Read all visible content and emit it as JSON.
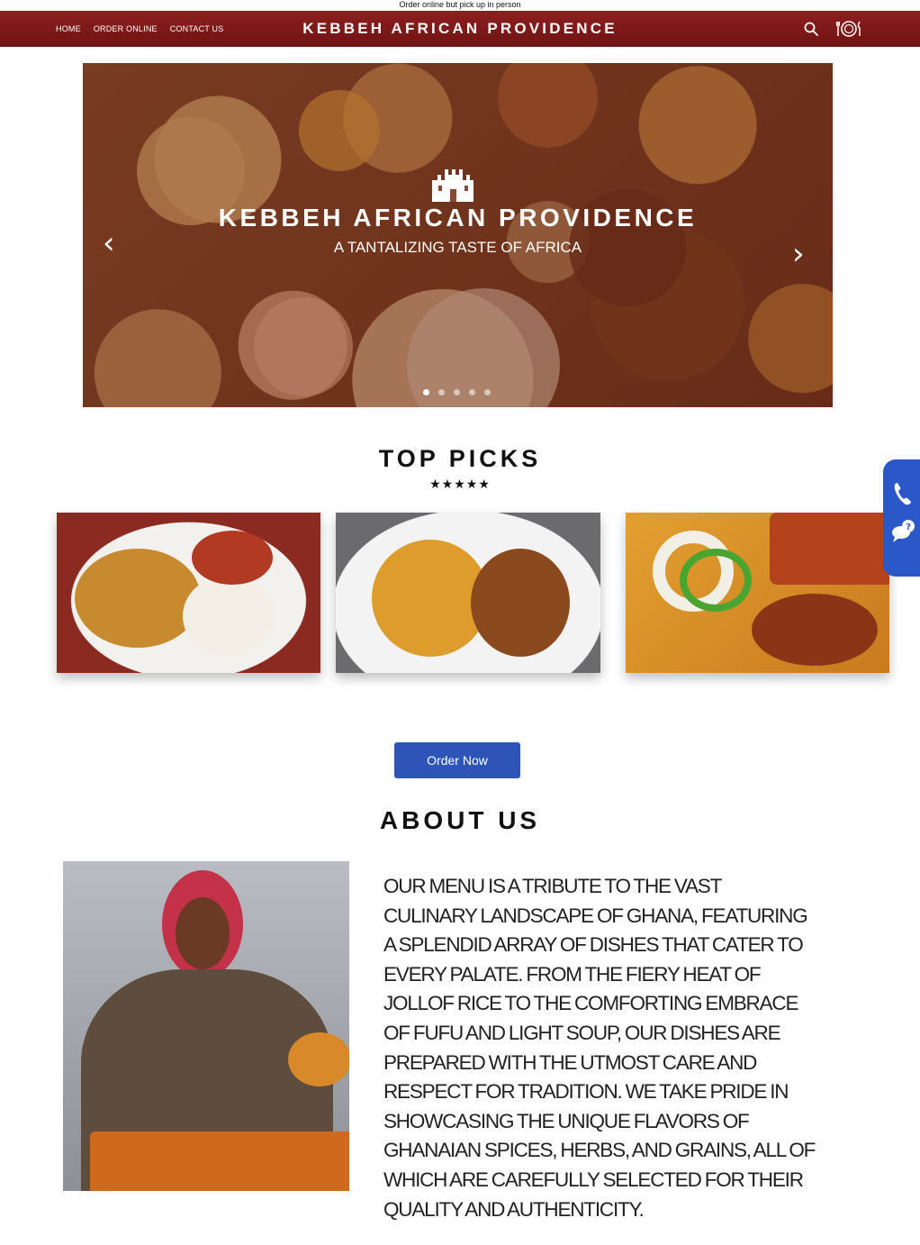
{
  "topbar": {
    "notice": "Order online but pick up in person"
  },
  "nav": {
    "links": [
      "HOME",
      "ORDER ONLINE",
      "CONTACT US"
    ],
    "brand": "KEBBEH AFRICAN PROVIDENCE"
  },
  "hero": {
    "title": "KEBBEH AFRICAN PROVIDENCE",
    "subtitle": "A TANTALIZING TASTE OF AFRICA",
    "prev_label": "‹",
    "next_label": "›",
    "slide_count": 5,
    "active_slide": 1
  },
  "top_picks": {
    "title": "TOP PICKS",
    "rating_display": "★★★★★",
    "rating": 5
  },
  "order": {
    "button_label": "Order Now"
  },
  "about": {
    "title": "ABOUT US",
    "body": "Our menu is a tribute to the vast culinary landscape of Ghana, featuring a splendid array of dishes that cater to every palate. From the fiery heat of Jollof rice to the comforting embrace of Fufu and light soup, our dishes are prepared with the utmost care and respect for tradition. We take pride in showcasing the unique flavors of Ghanaian spices, herbs, and grains, all of which are carefully selected for their quality and authenticity."
  },
  "colors": {
    "nav_bg": "#8f1f1f",
    "button_bg": "#2f54b8",
    "side_widget_bg": "#2b58c8"
  },
  "icons": [
    "search-icon",
    "plate-cutlery-icon",
    "castle-icon",
    "phone-icon",
    "chat-question-icon"
  ]
}
